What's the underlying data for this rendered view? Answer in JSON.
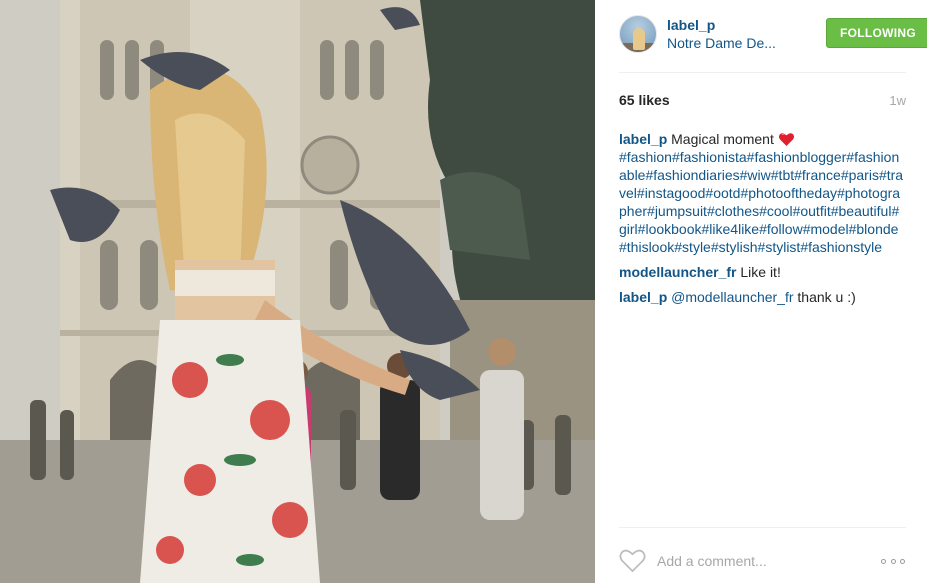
{
  "post": {
    "username": "label_p",
    "location": "Notre Dame De...",
    "follow_label": "FOLLOWING",
    "likes": "65 likes",
    "time_ago": "1w"
  },
  "caption": {
    "username": "label_p",
    "text": "Magical moment",
    "emoji": "red-heart-emoji",
    "hashtags": [
      "#fashion",
      "#fashionista",
      "#fashionblogger",
      "#fashionable",
      "#fashiondiaries",
      "#wiw",
      "#tbt",
      "#france",
      "#paris",
      "#travel",
      "#instagood",
      "#ootd",
      "#photooftheday",
      "#photographer",
      "#jumpsuit",
      "#clothes",
      "#cool",
      "#outfit",
      "#beautiful",
      "#girl",
      "#lookbook",
      "#like4like",
      "#follow",
      "#model",
      "#blonde",
      "#thislook",
      "#style",
      "#stylish",
      "#stylist",
      "#fashionstyle"
    ]
  },
  "comments": [
    {
      "username": "modellauncher_fr",
      "mention": "",
      "text": "Like it!"
    },
    {
      "username": "label_p",
      "mention": "@modellauncher_fr",
      "text": "thank u :)"
    }
  ],
  "footer": {
    "like_icon": "heart-outline-icon",
    "comment_placeholder": "Add a comment...",
    "more_icon": "more-options-icon"
  },
  "colors": {
    "link": "#125688",
    "follow_button": "#6bbe45",
    "muted": "#a5a7aa",
    "text": "#262626"
  }
}
